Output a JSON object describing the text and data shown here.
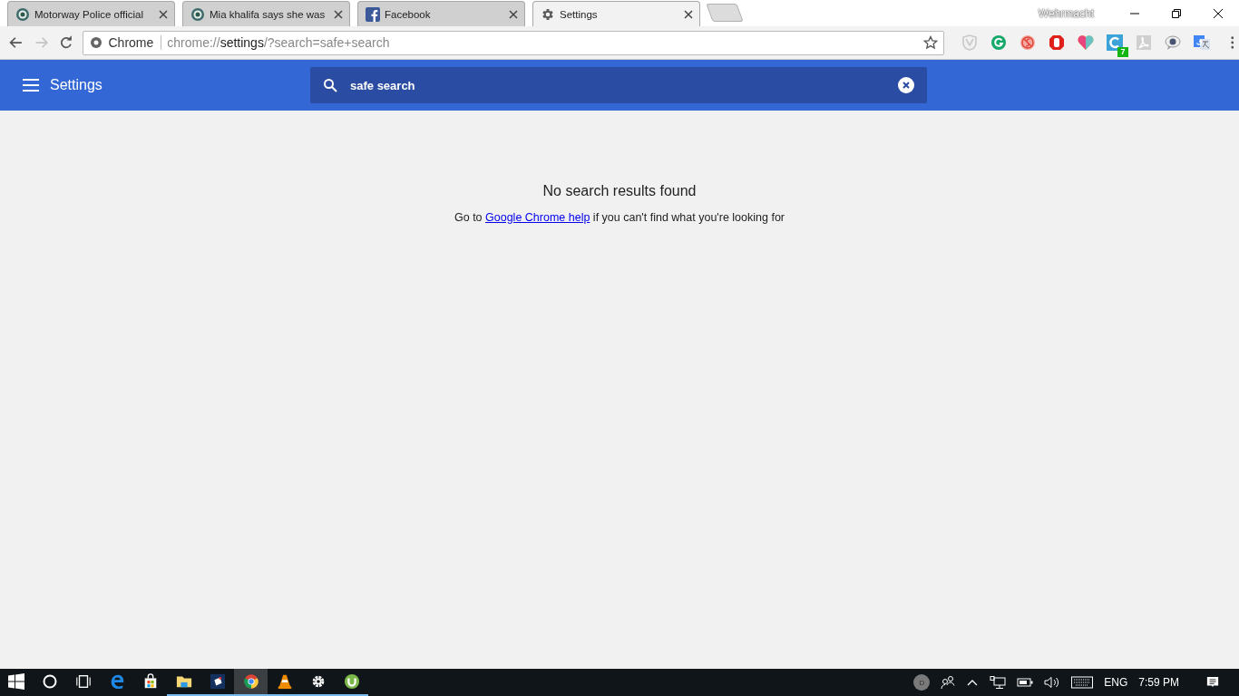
{
  "tabs": [
    {
      "kind": "site",
      "title": "Motorway Police official",
      "selected": false
    },
    {
      "kind": "site",
      "title": "Mia khalifa says she was",
      "selected": false
    },
    {
      "kind": "facebook",
      "title": "Facebook",
      "selected": false
    },
    {
      "kind": "settings",
      "title": "Settings",
      "selected": true
    }
  ],
  "profile": "Wehrmacht",
  "omnibox": {
    "chip": "Chrome",
    "url_scheme": "chrome://",
    "url_host": "settings",
    "url_rest": "/?search=safe+search"
  },
  "extensions": [
    {
      "kind": "shield"
    },
    {
      "kind": "grammar"
    },
    {
      "kind": "stamp"
    },
    {
      "kind": "hand"
    },
    {
      "kind": "heart"
    },
    {
      "kind": "letter-c",
      "badge": "7"
    },
    {
      "kind": "pdf"
    },
    {
      "kind": "bubble"
    },
    {
      "kind": "translate"
    }
  ],
  "header": {
    "title": "Settings",
    "search_value": "safe search"
  },
  "results": {
    "heading": "No search results found",
    "help_before": "Go to ",
    "help_link": "Google Chrome help",
    "help_after": " if you can't find what you're looking for"
  },
  "taskbar": {
    "apps": [
      {
        "kind": "edge",
        "running": false,
        "selected": false
      },
      {
        "kind": "store",
        "running": false,
        "selected": false
      },
      {
        "kind": "folder",
        "running": true,
        "selected": false
      },
      {
        "kind": "note",
        "running": true,
        "selected": false
      },
      {
        "kind": "chrome",
        "running": true,
        "selected": true
      },
      {
        "kind": "cone",
        "running": true,
        "selected": false
      },
      {
        "kind": "gear",
        "running": true,
        "selected": false
      },
      {
        "kind": "torrent",
        "running": true,
        "selected": false
      }
    ],
    "avatar_letter": "D",
    "language": "ENG",
    "time": "7:59 PM"
  }
}
